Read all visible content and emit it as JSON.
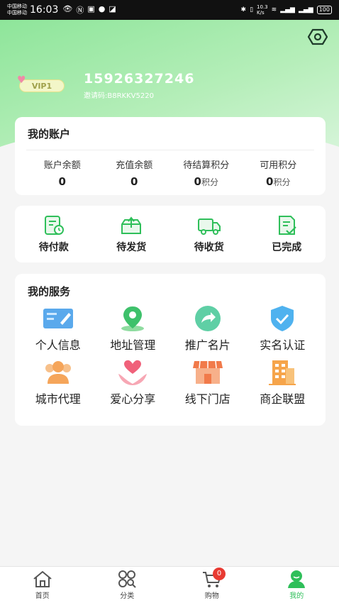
{
  "status_bar": {
    "carrier_1": "中国移动",
    "carrier_2": "中国移动",
    "time": "16:03",
    "net_speed": "10.3\nK/s",
    "battery": "100"
  },
  "profile": {
    "phone": "15926327246",
    "invite_code": "邀请码:B8RKKV5220",
    "vip_level": "VIP1"
  },
  "account": {
    "title": "我的账户",
    "items": [
      {
        "label": "账户余额",
        "value": "0",
        "unit": ""
      },
      {
        "label": "充值余额",
        "value": "0",
        "unit": ""
      },
      {
        "label": "待结算积分",
        "value": "0",
        "unit": "积分"
      },
      {
        "label": "可用积分",
        "value": "0",
        "unit": "积分"
      }
    ]
  },
  "orders": {
    "items": [
      {
        "label": "待付款",
        "icon": "pending-payment-icon"
      },
      {
        "label": "待发货",
        "icon": "pending-shipment-icon"
      },
      {
        "label": "待收货",
        "icon": "delivery-truck-icon"
      },
      {
        "label": "已完成",
        "icon": "completed-document-icon"
      }
    ]
  },
  "services": {
    "title": "我的服务",
    "items": [
      {
        "label": "个人信息",
        "icon": "profile-card-icon"
      },
      {
        "label": "地址管理",
        "icon": "location-pin-icon"
      },
      {
        "label": "推广名片",
        "icon": "share-arrow-icon"
      },
      {
        "label": "实名认证",
        "icon": "verified-shield-icon"
      },
      {
        "label": "城市代理",
        "icon": "users-group-icon"
      },
      {
        "label": "爱心分享",
        "icon": "heart-hands-icon"
      },
      {
        "label": "线下门店",
        "icon": "storefront-icon"
      },
      {
        "label": "商企联盟",
        "icon": "office-building-icon"
      }
    ]
  },
  "tabbar": {
    "items": [
      {
        "label": "首页",
        "icon": "home-icon"
      },
      {
        "label": "分类",
        "icon": "category-icon"
      },
      {
        "label": "购物",
        "icon": "cart-icon"
      },
      {
        "label": "我的",
        "icon": "profile-icon"
      }
    ],
    "cart_count": "0",
    "active_index": 3
  },
  "colors": {
    "accent": "#2fbf5a",
    "header_green": "#8ee59a",
    "badge_red": "#e83a32"
  }
}
